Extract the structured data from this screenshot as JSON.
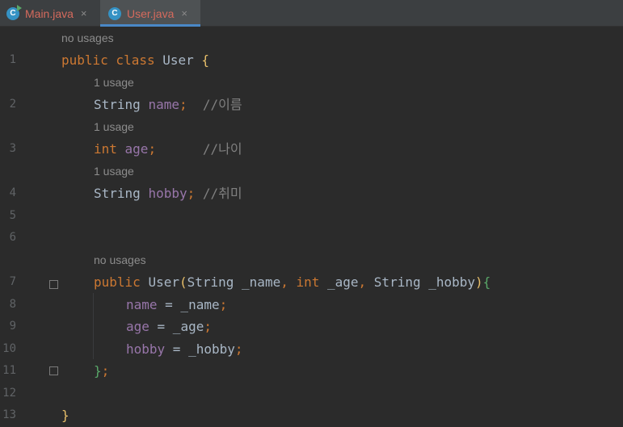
{
  "tabs": [
    {
      "label": "Main.java",
      "close": "×"
    },
    {
      "label": "User.java",
      "close": "×"
    }
  ],
  "hints": {
    "h0": "no usages",
    "h1": "1 usage",
    "h2": "1 usage",
    "h3": "1 usage",
    "h4": "no usages"
  },
  "lines": {
    "n1": "1",
    "n2": "2",
    "n3": "3",
    "n4": "4",
    "n5": "5",
    "n6": "6",
    "n7": "7",
    "n8": "8",
    "n9": "9",
    "n10": "10",
    "n11": "11",
    "n12": "12",
    "n13": "13"
  },
  "code": {
    "l1_kw": "public class ",
    "l1_cls": "User",
    "l1_brace": " {",
    "l2_type": "String ",
    "l2_fld": "name",
    "l2_semi": ";",
    "l2_cmt": "  //이름",
    "l3_kw": "int ",
    "l3_fld": "age",
    "l3_semi": ";",
    "l3_cmt": "      //나이",
    "l4_type": "String ",
    "l4_fld": "hobby",
    "l4_semi": ";",
    "l4_cmt": " //취미",
    "l7_kw": "public ",
    "l7_ctor": "User",
    "l7_p1": "(",
    "l7_t1": "String _name",
    "l7_c1": ", ",
    "l7_k2": "int ",
    "l7_t2": "_age",
    "l7_c2": ", ",
    "l7_t3": "String _hobby",
    "l7_p2": ")",
    "l7_b": "{",
    "l8_fld": "name",
    "l8_rest": " = _name",
    "l8_semi": ";",
    "l9_fld": "age",
    "l9_rest": " = _age",
    "l9_semi": ";",
    "l10_fld": "hobby",
    "l10_rest": " = _hobby",
    "l10_semi": ";",
    "l11_b": "}",
    "l11_semi": ";",
    "l13_b": "}"
  }
}
